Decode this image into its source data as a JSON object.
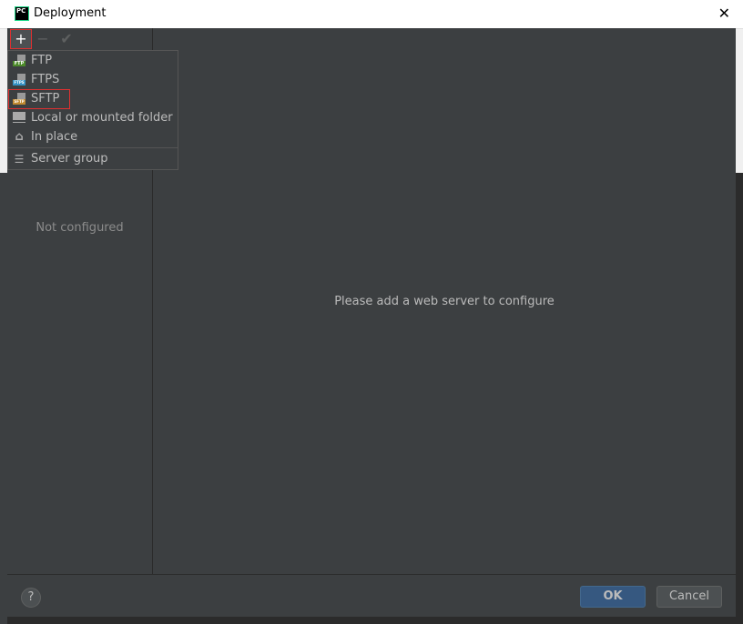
{
  "window": {
    "title": "Deployment",
    "close": "✕",
    "logo": "PC"
  },
  "toolbar": {
    "add": "+",
    "remove": "−",
    "apply": "✔"
  },
  "add_menu": {
    "items": [
      {
        "label": "FTP",
        "icon": "ftp-icon",
        "badge": "FTP",
        "color": "#4c8a2a"
      },
      {
        "label": "FTPS",
        "icon": "ftps-icon",
        "badge": "FTPS",
        "color": "#3592c4"
      },
      {
        "label": "SFTP",
        "icon": "sftp-icon",
        "badge": "SFTP",
        "color": "#c08a30"
      },
      {
        "label": "Local or mounted folder",
        "icon": "folder-network-icon"
      },
      {
        "label": "In place",
        "icon": "home-icon"
      },
      {
        "label": "Server group",
        "icon": "server-group-icon"
      }
    ],
    "highlighted": "SFTP"
  },
  "left_pane": {
    "empty_text": "Not configured"
  },
  "main": {
    "message": "Please add a web server to configure"
  },
  "footer": {
    "help": "?",
    "ok": "OK",
    "cancel": "Cancel"
  }
}
